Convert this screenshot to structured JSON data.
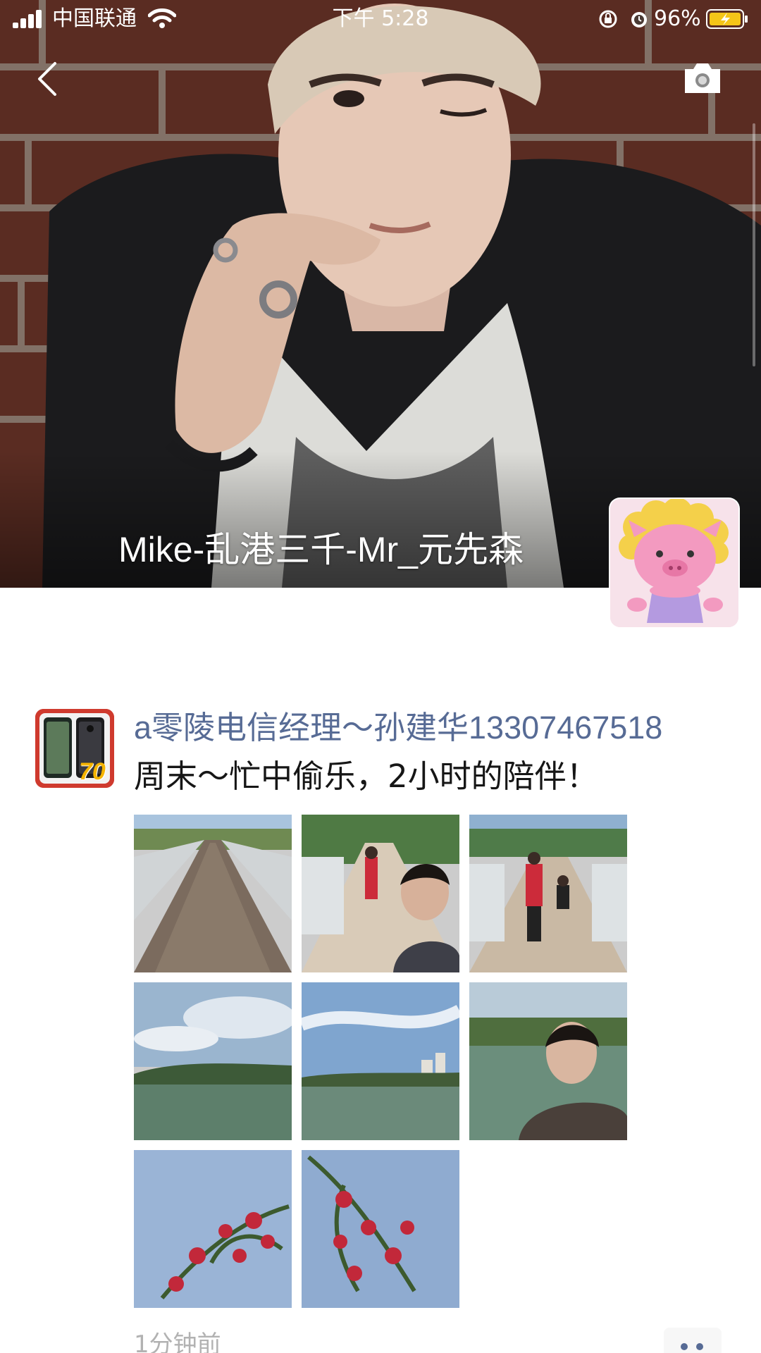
{
  "status_bar": {
    "carrier": "中国联通",
    "time": "下午 5:28",
    "battery_percent": "96%"
  },
  "profile": {
    "name": "Mike-乱港三千-Mr_元先森"
  },
  "post": {
    "author": "a零陵电信经理～孙建华13307467518",
    "text": "周末～忙中偷乐，2小时的陪伴！",
    "avatar_badge": "70",
    "time": "1分钟前",
    "photo_count": 8
  },
  "colors": {
    "link_blue": "#576b95",
    "muted_gray": "#b2b2b2",
    "battery_yellow": "#f5c518"
  }
}
